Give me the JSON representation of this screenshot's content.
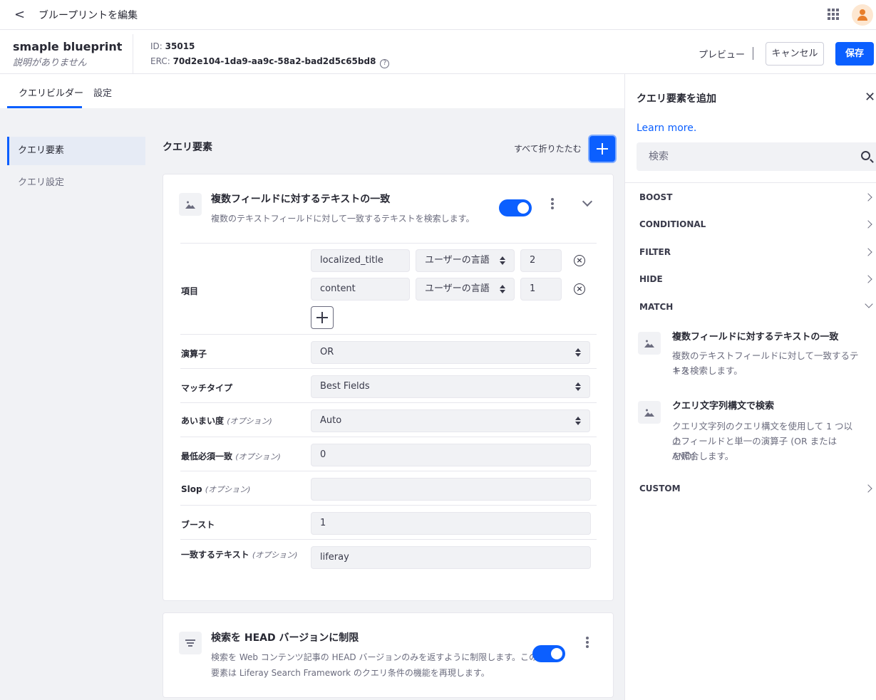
{
  "topbar": {
    "back_glyph": "<",
    "title": "ブループリントを編集",
    "apps_icon": "apps-icon",
    "avatar_icon": "user-icon"
  },
  "header": {
    "name": "smaple blueprint",
    "description": "説明がありません",
    "id_label": "ID:",
    "id_value": "35015",
    "erc_label": "ERC:",
    "erc_value": "70d2e104-1da9-aa9c-58a2-bad2d5c65bd8",
    "preview_label": "プレビュー",
    "cancel_label": "キャンセル",
    "save_label": "保存"
  },
  "tabs": [
    {
      "label": "クエリビルダー",
      "active": true
    },
    {
      "label": "設定",
      "active": false
    }
  ],
  "sidenav": [
    {
      "label": "クエリ要素",
      "active": true
    },
    {
      "label": "クエリ設定",
      "active": false
    }
  ],
  "main": {
    "section_title": "クエリ要素",
    "collapse_all_label": "すべて折りたたむ"
  },
  "card1": {
    "title": "複数フィールドに対するテキストの一致",
    "description": "複数のテキストフィールドに対して一致するテキストを検索します。",
    "enabled": true,
    "fields_label": "項目",
    "fields": [
      {
        "name": "localized_title",
        "locale": "ユーザーの言語",
        "boost": "2"
      },
      {
        "name": "content",
        "locale": "ユーザーの言語",
        "boost": "1"
      }
    ],
    "operator_label": "演算子",
    "operator_value": "OR",
    "match_type_label": "マッチタイプ",
    "match_type_value": "Best Fields",
    "fuzziness_label": "あいまい度",
    "fuzziness_value": "Auto",
    "min_match_label": "最低必須一致",
    "min_match_value": "0",
    "slop_label": "Slop",
    "slop_value": "",
    "boost_label": "ブースト",
    "boost_value": "1",
    "text_label": "一致するテキスト",
    "text_value": "liferay",
    "optional_label": "(オプション)"
  },
  "card2": {
    "title": "検索を HEAD バージョンに制限",
    "description_line1": "検索を Web コンテンツ記事の HEAD バージョンのみを返すように制限します。この",
    "description_line2": "要素は Liferay Search Framework のクエリ条件の機能を再現します。",
    "enabled": true
  },
  "panel": {
    "title": "クエリ要素を追加",
    "learn_more": "Learn more.",
    "search_placeholder": "検索",
    "categories": {
      "boost": "BOOST",
      "conditional": "CONDITIONAL",
      "filter": "FILTER",
      "hide": "HIDE",
      "match": "MATCH",
      "custom": "CUSTOM"
    },
    "match_elements": [
      {
        "title": "複数フィールドに対するテキストの一致",
        "description_line1": "複数のテキストフィールドに対して一致するテキス",
        "description_line2": "トを検索します。"
      },
      {
        "title": "クエリ文字列構文で検索",
        "description_line1": "クエリ文字列のクエリ構文を使用して 1 つ以上",
        "description_line2": "のフィールドと単一の演算子 (OR または AND)",
        "description_line3": "を照合します。"
      }
    ]
  }
}
